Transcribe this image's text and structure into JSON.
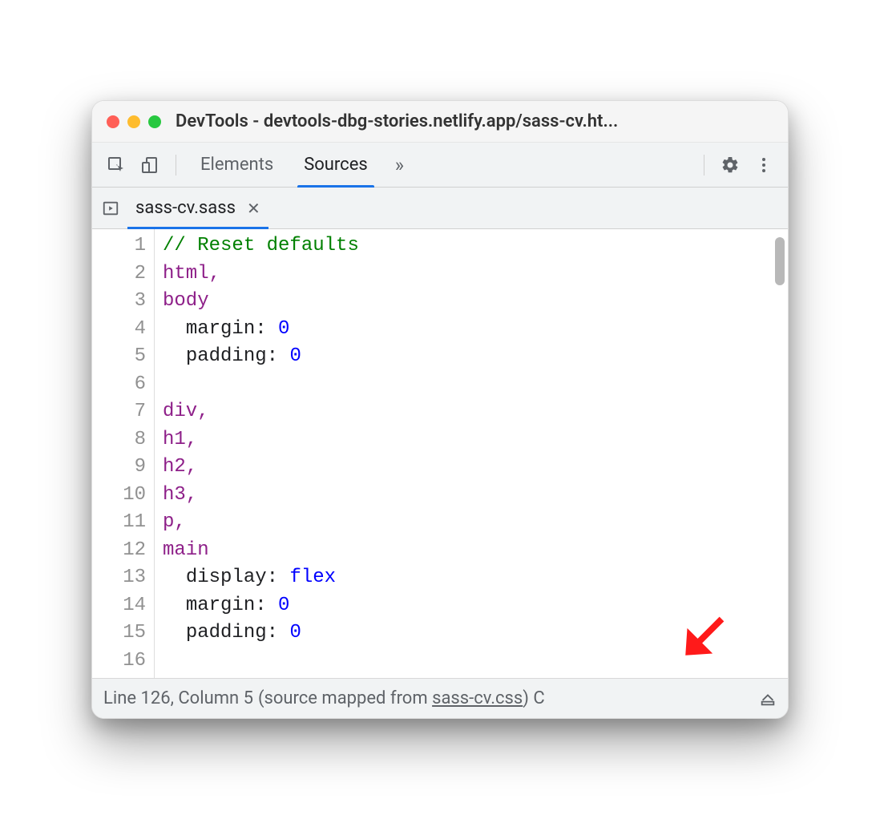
{
  "window": {
    "title": "DevTools - devtools-dbg-stories.netlify.app/sass-cv.ht..."
  },
  "toolbar": {
    "tabs": {
      "elements": "Elements",
      "sources": "Sources"
    }
  },
  "fileTab": {
    "name": "sass-cv.sass"
  },
  "code": {
    "lines": [
      {
        "n": 1,
        "t": "comment",
        "indent": "",
        "text": "// Reset defaults"
      },
      {
        "n": 2,
        "t": "selector",
        "indent": "",
        "text": "html",
        "comma": true
      },
      {
        "n": 3,
        "t": "selector",
        "indent": "",
        "text": "body"
      },
      {
        "n": 4,
        "t": "decl",
        "indent": "  ",
        "prop": "margin",
        "value": "0",
        "valueType": "num"
      },
      {
        "n": 5,
        "t": "decl",
        "indent": "  ",
        "prop": "padding",
        "value": "0",
        "valueType": "num"
      },
      {
        "n": 6,
        "t": "blank",
        "indent": "",
        "text": ""
      },
      {
        "n": 7,
        "t": "selector",
        "indent": "",
        "text": "div",
        "comma": true
      },
      {
        "n": 8,
        "t": "selector",
        "indent": "",
        "text": "h1",
        "comma": true
      },
      {
        "n": 9,
        "t": "selector",
        "indent": "",
        "text": "h2",
        "comma": true
      },
      {
        "n": 10,
        "t": "selector",
        "indent": "",
        "text": "h3",
        "comma": true
      },
      {
        "n": 11,
        "t": "selector",
        "indent": "",
        "text": "p",
        "comma": true
      },
      {
        "n": 12,
        "t": "selector",
        "indent": "",
        "text": "main"
      },
      {
        "n": 13,
        "t": "decl",
        "indent": "  ",
        "prop": "display",
        "value": "flex",
        "valueType": "kw"
      },
      {
        "n": 14,
        "t": "decl",
        "indent": "  ",
        "prop": "margin",
        "value": "0",
        "valueType": "num"
      },
      {
        "n": 15,
        "t": "decl",
        "indent": "  ",
        "prop": "padding",
        "value": "0",
        "valueType": "num"
      },
      {
        "n": 16,
        "t": "blank",
        "indent": "",
        "text": ""
      }
    ]
  },
  "status": {
    "position": "Line 126, Column 5",
    "mappedPrefix": "(source mapped from ",
    "mappedLink": "sass-cv.css",
    "mappedSuffix": ")",
    "trailing": " C"
  }
}
